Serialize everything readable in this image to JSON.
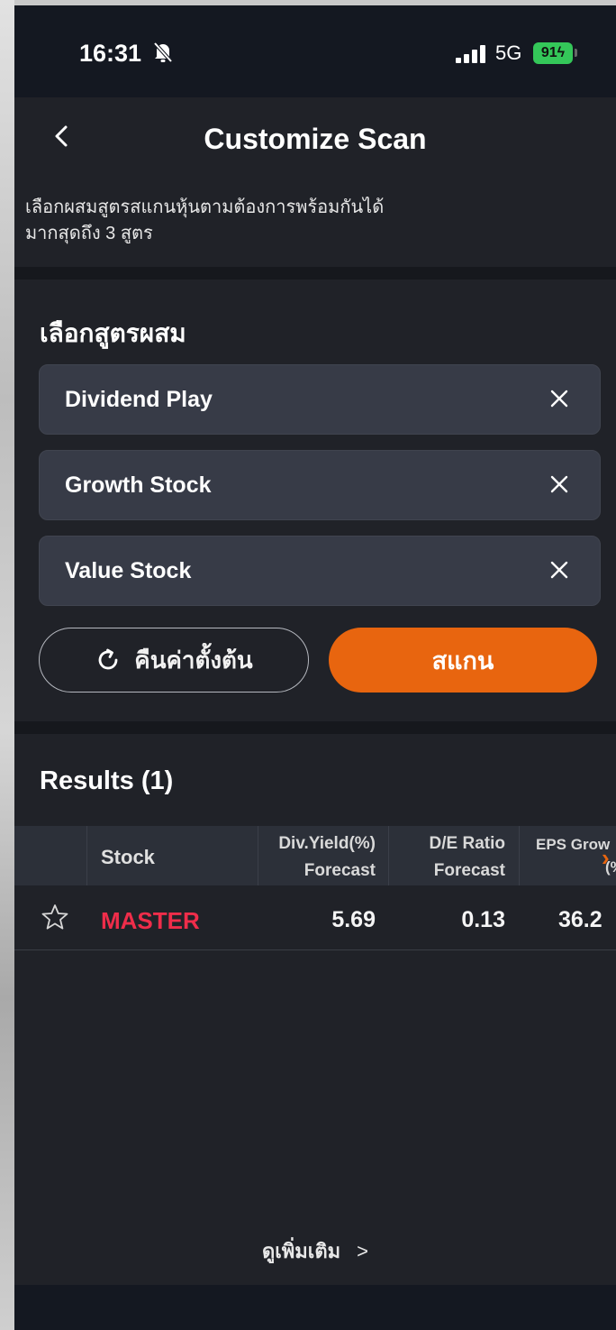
{
  "status_bar": {
    "time": "16:31",
    "network": "5G",
    "battery": "91"
  },
  "header": {
    "title": "Customize Scan",
    "description_line1": "เลือกผสมสูตรสแกนหุ้นตามต้องการพร้อมกันได้",
    "description_line2": "มากสุดถึง 3 สูตร"
  },
  "formula": {
    "title": "เลือกสูตรผสม",
    "chips": [
      "Dividend Play",
      "Growth Stock",
      "Value Stock"
    ],
    "reset_label": "คืนค่าตั้งต้น",
    "scan_label": "สแกน"
  },
  "results": {
    "title": "Results (1)",
    "columns": {
      "stock": "Stock",
      "div_line1": "Div.Yield(%)",
      "div_line2": "Forecast",
      "de_line1": "D/E Ratio",
      "de_line2": "Forecast",
      "eps_line1": "EPS Grow",
      "eps_line2": "(%"
    },
    "rows": [
      {
        "stock": "MASTER",
        "div_yield": "5.69",
        "de_ratio": "0.13",
        "eps_growth": "36.2"
      }
    ],
    "see_more": "ดูเพิ่มเติม"
  },
  "colors": {
    "accent": "#e8650f",
    "stock_red": "#ef2d4a",
    "background": "#202228"
  }
}
